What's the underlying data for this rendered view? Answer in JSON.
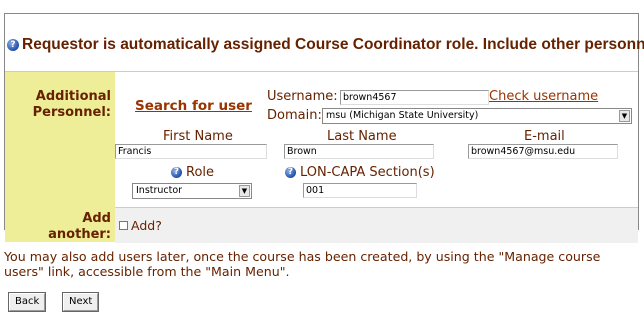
{
  "heading": "Requestor is automatically assigned Course Coordinator role. Include other personnel?",
  "personnel": {
    "label_line1": "Additional",
    "label_line2": "Personnel:",
    "search_link": "Search for user",
    "username_label": "Username:",
    "username_value": "brown4567",
    "check_username_link": "Check username",
    "domain_label": "Domain:",
    "domain_value": "msu (Michigan State University)",
    "first_name_label": "First Name",
    "first_name_value": "Francis",
    "last_name_label": "Last Name",
    "last_name_value": "Brown",
    "email_label": "E-mail",
    "email_value": "brown4567@msu.edu",
    "role_label": "Role",
    "role_value": "Instructor",
    "section_label": "LON-CAPA Section(s)",
    "section_value": "001"
  },
  "add_another": {
    "label_line1": "Add",
    "label_line2": "another:",
    "checkbox_label": "Add?"
  },
  "note": "You may also add users later, once the course has been created, by using the \"Manage course users\" link, accessible from the \"Main Menu\".",
  "buttons": {
    "back": "Back",
    "next": "Next"
  },
  "icons": {
    "help": "help-icon",
    "select_arrow": "chevron-down-icon"
  },
  "colors": {
    "label_bg": "#eeee99",
    "text_brown": "#662200",
    "link": "#993300"
  }
}
